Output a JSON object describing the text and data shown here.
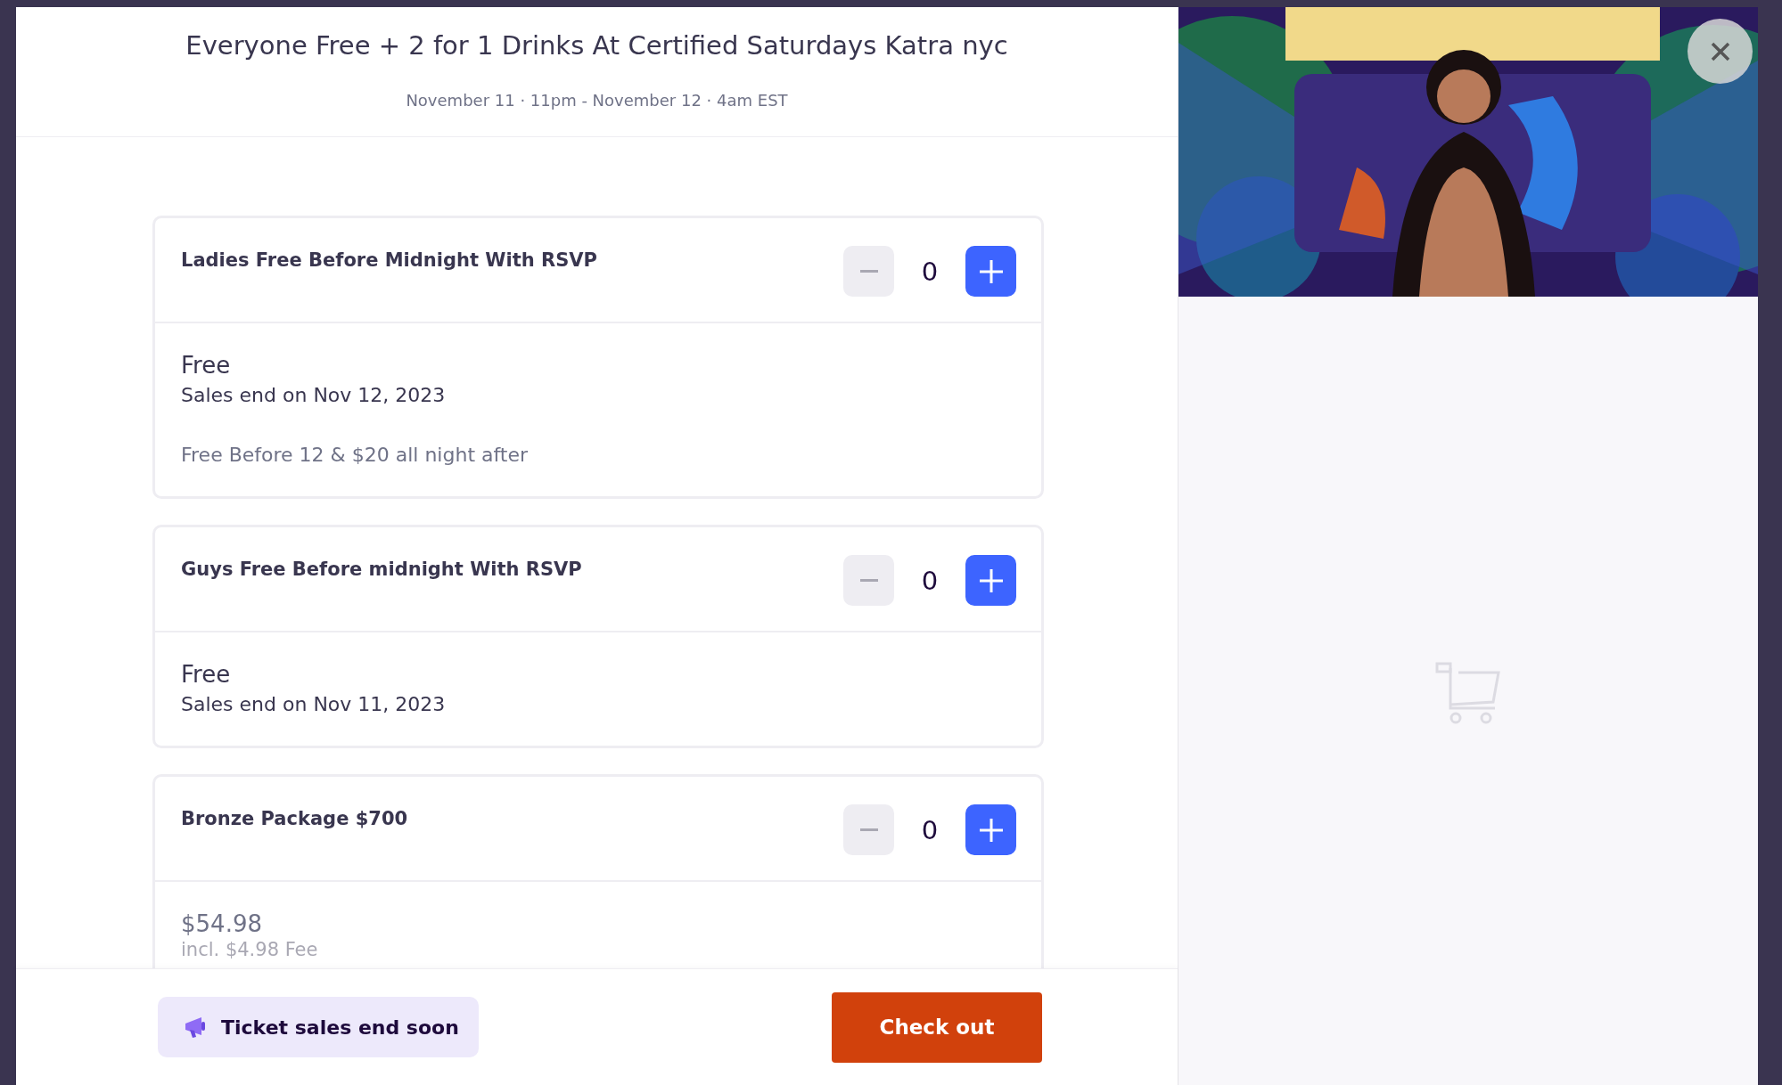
{
  "event": {
    "title": "Everyone Free + 2 for 1 Drinks At Certified Saturdays Katra nyc",
    "date": "November 11 · 11pm - November 12 · 4am EST"
  },
  "tickets": [
    {
      "name": "Ladies Free Before Midnight With RSVP",
      "quantity": "0",
      "decrement_disabled": true,
      "price": "Free",
      "price_muted": false,
      "sales_end": "Sales end on Nov 12, 2023",
      "description": "Free Before 12 & $20 all night after"
    },
    {
      "name": "Guys Free Before midnight With RSVP",
      "quantity": "0",
      "decrement_disabled": true,
      "price": "Free",
      "price_muted": false,
      "sales_end": "Sales end on Nov 11, 2023"
    },
    {
      "name": "Bronze Package $700",
      "quantity": "0",
      "decrement_disabled": true,
      "price": "$54.98",
      "price_muted": true,
      "fee": "incl. $4.98 Fee"
    }
  ],
  "footer": {
    "notice": "Ticket sales end soon",
    "checkout_button": "Check out"
  },
  "cart": {
    "empty": true
  }
}
